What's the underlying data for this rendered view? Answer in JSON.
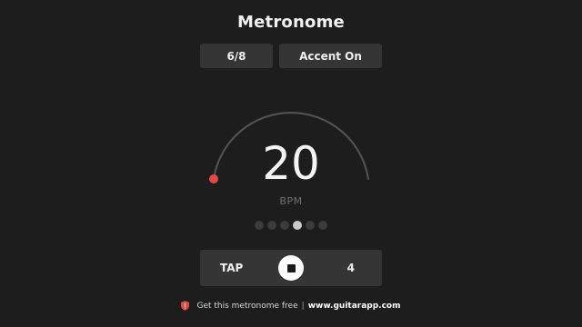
{
  "header": {
    "title": "Metronome"
  },
  "settings": {
    "time_signature": "6/8",
    "accent_label": "Accent On"
  },
  "tempo": {
    "bpm": "20",
    "unit": "BPM",
    "dial_level": 0.0
  },
  "beats": {
    "total": 6,
    "active_index": 3
  },
  "controls": {
    "tap_label": "TAP",
    "count": "4"
  },
  "footer": {
    "text": "Get this metronome free",
    "separator": "|",
    "link": "www.guitarapp.com"
  },
  "colors": {
    "background": "#1d1d1d",
    "panel": "#353535",
    "dial_track": "#555555",
    "dial_knob": "#e5483f",
    "shield": "#e5483f"
  },
  "icons": {
    "stop": "stop-icon",
    "footer": "shield-icon"
  }
}
